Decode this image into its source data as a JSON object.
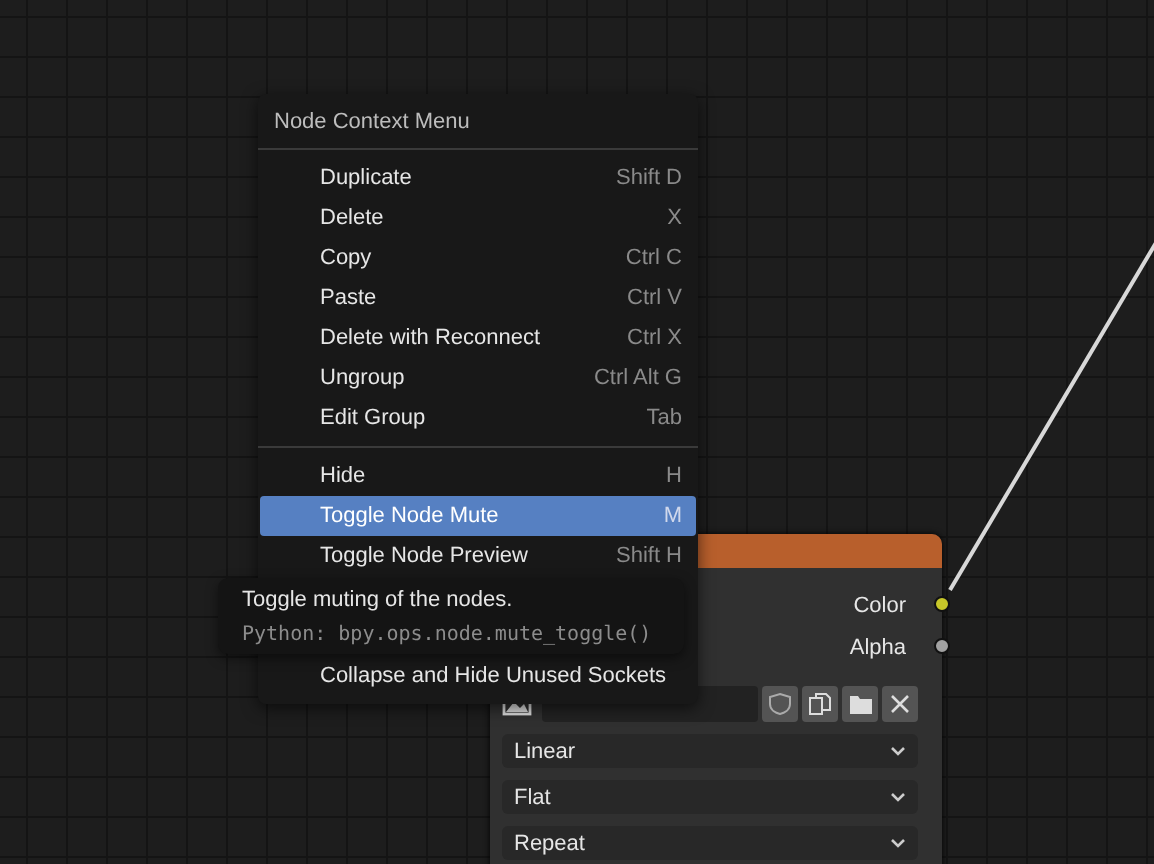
{
  "menu": {
    "title": "Node Context Menu",
    "groups": [
      {
        "items": [
          {
            "kind": "item",
            "label": "Duplicate",
            "shortcut": "Shift D",
            "selected": false
          },
          {
            "kind": "item",
            "label": "Delete",
            "shortcut": "X",
            "selected": false
          },
          {
            "kind": "item",
            "label": "Copy",
            "shortcut": "Ctrl C",
            "selected": false
          },
          {
            "kind": "item",
            "label": "Paste",
            "shortcut": "Ctrl V",
            "selected": false
          },
          {
            "kind": "item",
            "label": "Delete with Reconnect",
            "shortcut": "Ctrl X",
            "selected": false
          },
          {
            "kind": "item",
            "label": "Ungroup",
            "shortcut": "Ctrl Alt G",
            "selected": false
          },
          {
            "kind": "item",
            "label": "Edit Group",
            "shortcut": "Tab",
            "selected": false
          }
        ]
      },
      {
        "items": [
          {
            "kind": "item",
            "label": "Hide",
            "shortcut": "H",
            "selected": false
          },
          {
            "kind": "item",
            "label": "Toggle Node Mute",
            "shortcut": "M",
            "selected": true
          },
          {
            "kind": "item",
            "label": "Toggle Node Preview",
            "shortcut": "Shift H",
            "selected": false
          },
          {
            "kind": "covered"
          },
          {
            "kind": "covered"
          },
          {
            "kind": "item",
            "label": "Collapse and Hide Unused Sockets",
            "selected": false
          }
        ]
      }
    ]
  },
  "tooltip": {
    "description": "Toggle muting of the nodes.",
    "python": "Python: bpy.ops.node.mute_toggle()"
  },
  "node": {
    "outputs": [
      {
        "name": "Color",
        "color": "#c7c729"
      },
      {
        "name": "Alpha",
        "color": "#a1a1a1"
      }
    ],
    "dropdowns": [
      "Linear",
      "Flat",
      "Repeat"
    ]
  }
}
